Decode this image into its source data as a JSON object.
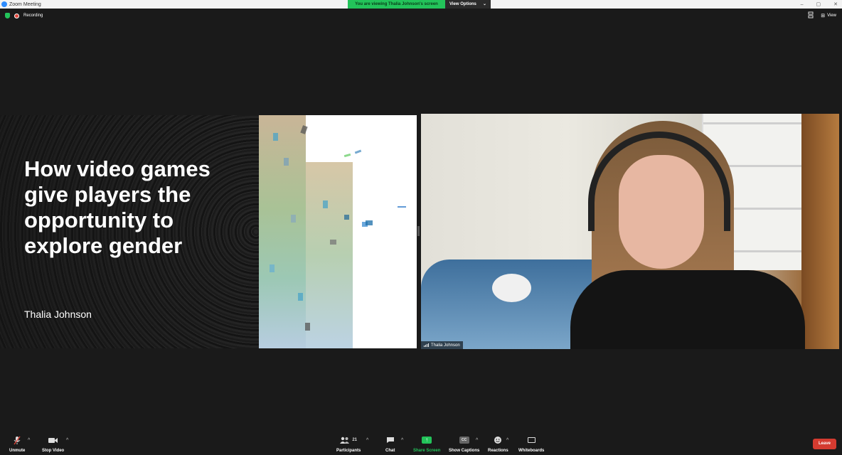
{
  "window": {
    "title": "Zoom Meeting",
    "controls": [
      "–",
      "▢",
      "✕"
    ]
  },
  "banner": {
    "viewing_text": "You are viewing Thalia Johnson's screen",
    "view_options_label": "View Options"
  },
  "status": {
    "recording_label": "Recording"
  },
  "top_right": {
    "view_label": "View"
  },
  "shared_screen": {
    "title": "How video games give players the opportunity to explore gender",
    "author": "Thalia Johnson"
  },
  "participant_video": {
    "name": "Thalia Johnson"
  },
  "toolbar": {
    "unmute_label": "Unmute",
    "stop_video_label": "Stop Video",
    "participants_label": "Participants",
    "participants_count": "21",
    "chat_label": "Chat",
    "share_screen_label": "Share Screen",
    "show_captions_label": "Show Captions",
    "cc_icon_text": "CC",
    "reactions_label": "Reactions",
    "whiteboards_label": "Whiteboards",
    "leave_label": "Leave"
  },
  "colors": {
    "accent_green": "#23c35a",
    "leave_red": "#d43b30",
    "zoom_blue": "#2d8cff",
    "recording_red": "#e0453a"
  },
  "icons": [
    "zoom-logo-icon",
    "shield-icon",
    "recording-icon",
    "camera-flip-icon",
    "grid-view-icon",
    "mic-muted-icon",
    "video-camera-icon",
    "participants-icon",
    "chat-icon",
    "share-arrow-icon",
    "captions-icon",
    "reactions-icon",
    "whiteboard-icon",
    "signal-bars-icon",
    "chevron-up-icon"
  ]
}
